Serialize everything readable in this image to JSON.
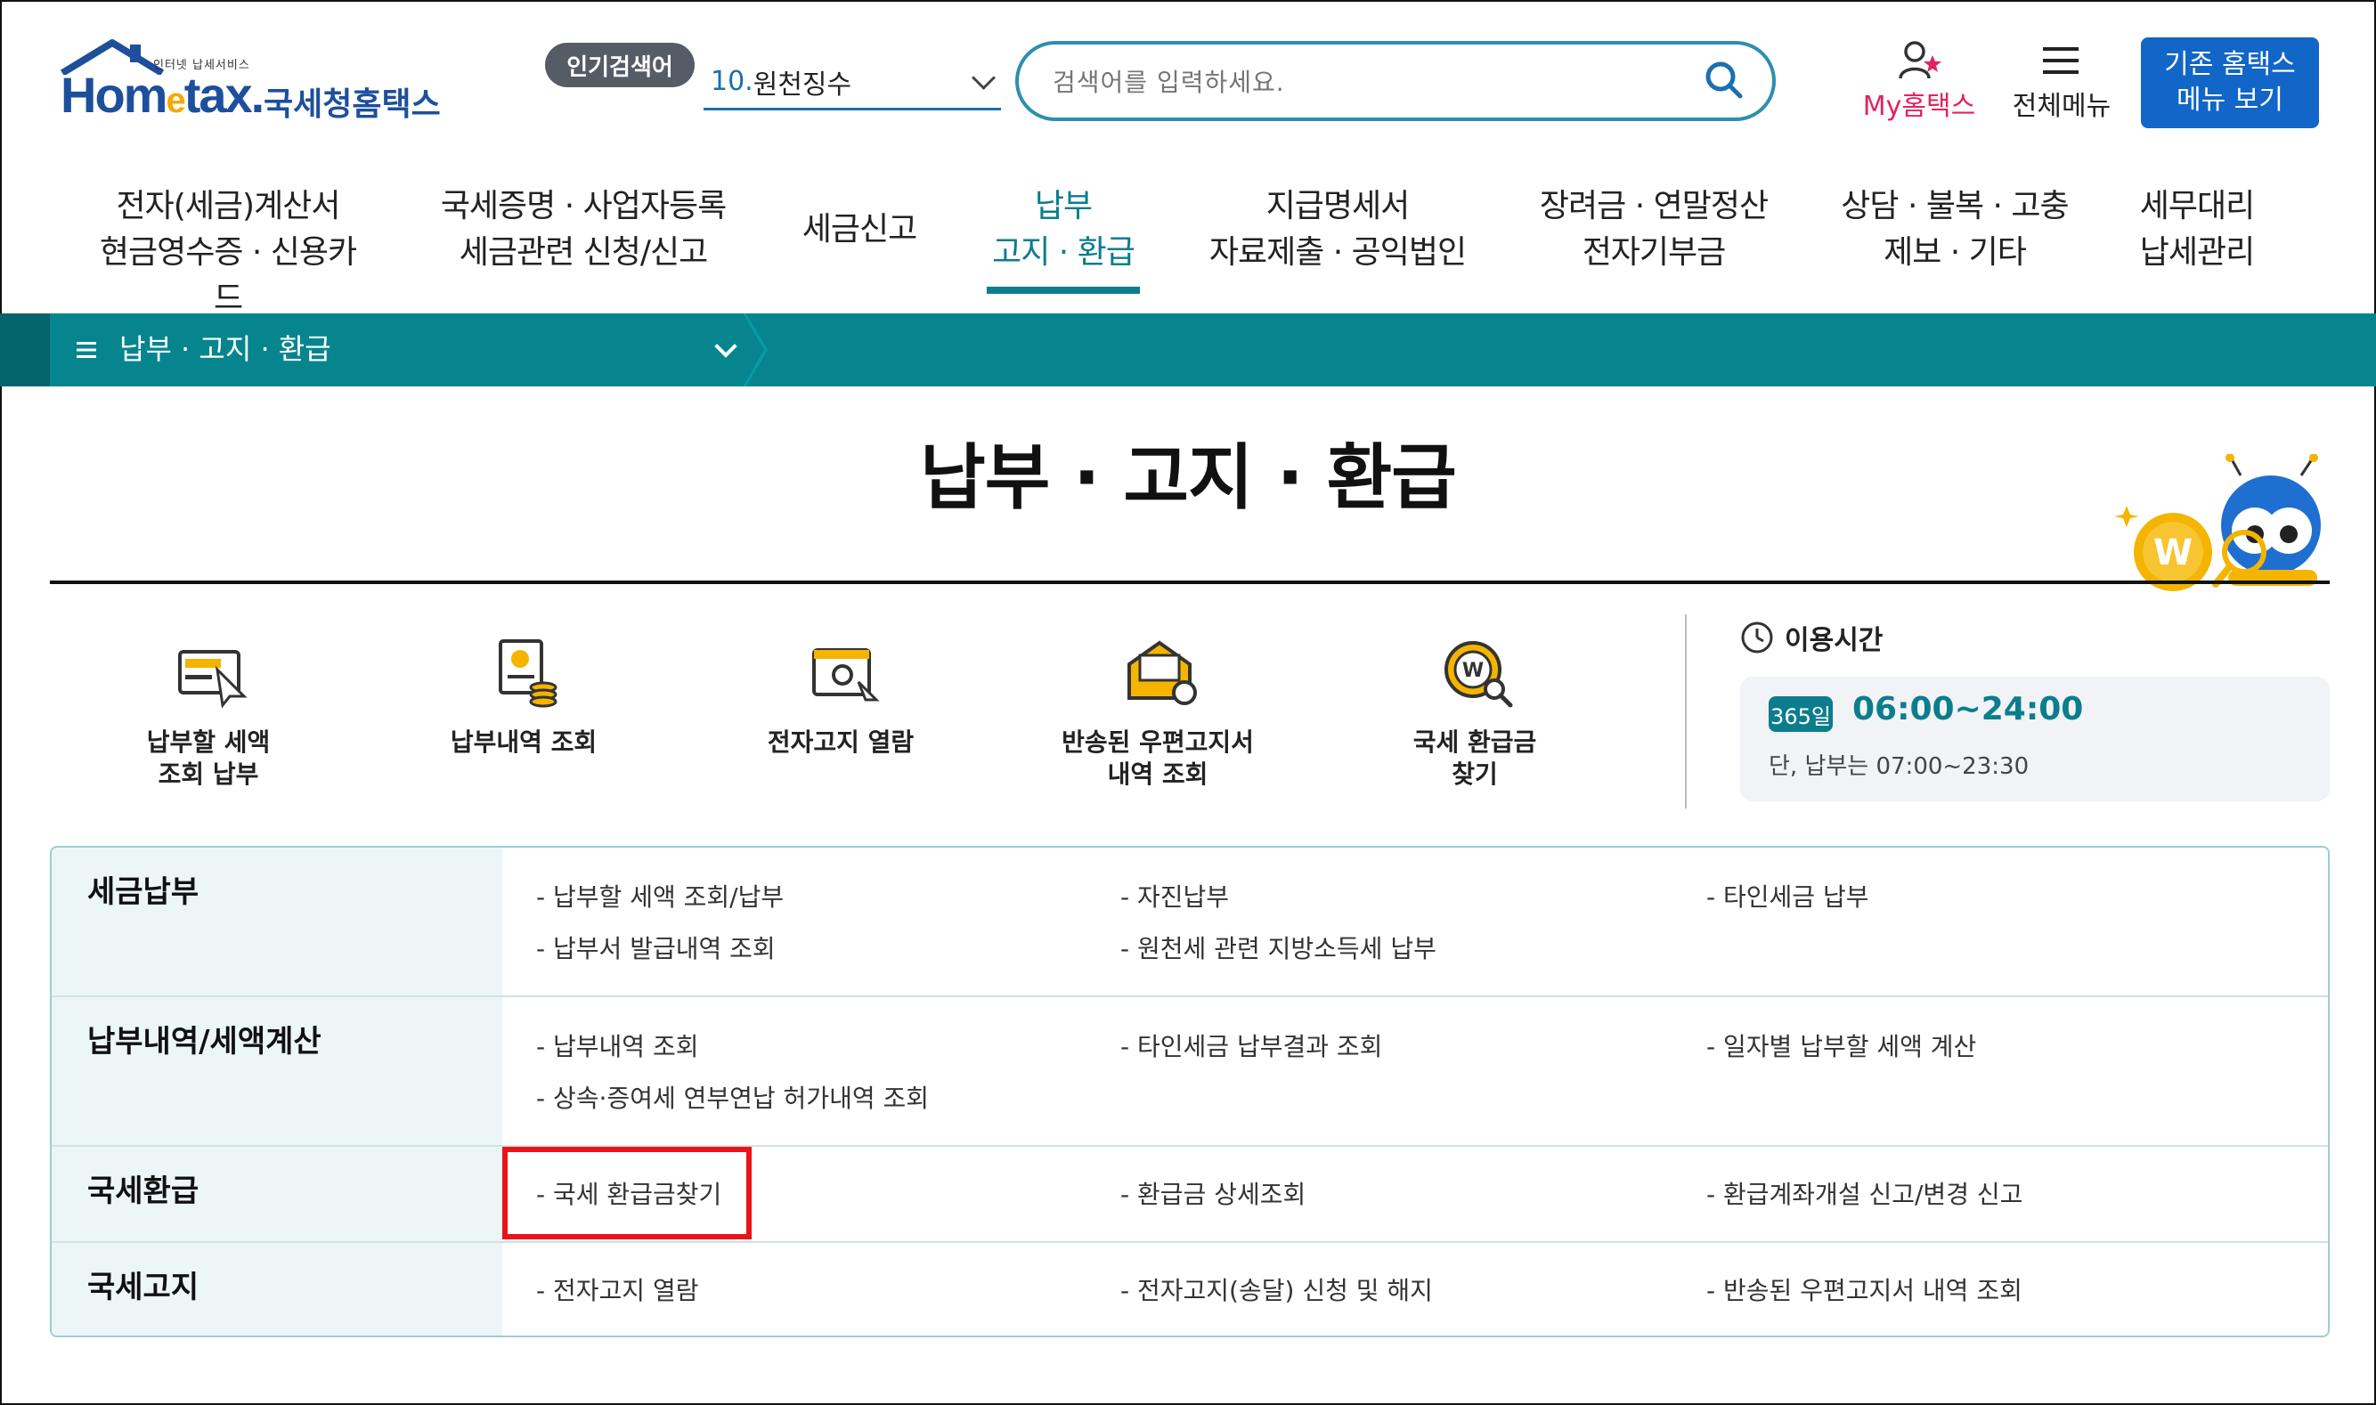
{
  "header": {
    "logo_small": "인터넷 납세서비스",
    "logo_main_prefix": "Hom",
    "logo_main_e": "e",
    "logo_main_suffix": "tax.",
    "logo_kr": "국세청홈택스",
    "popular_badge": "인기검색어",
    "popular_num": "10.",
    "popular_value": "원천징수",
    "search_placeholder": "검색어를 입력하세요.",
    "my_hometax": "My홈택스",
    "all_menu": "전체메뉴",
    "old_menu_line1": "기존 홈택스",
    "old_menu_line2": "메뉴 보기"
  },
  "gnb": [
    {
      "line1": "전자(세금)계산서",
      "line2": "현금영수증 · 신용카드"
    },
    {
      "line1": "국세증명 · 사업자등록",
      "line2": "세금관련 신청/신고"
    },
    {
      "line1": "세금신고",
      "line2": ""
    },
    {
      "line1": "납부",
      "line2": "고지 · 환급"
    },
    {
      "line1": "지급명세서",
      "line2": "자료제출 · 공익법인"
    },
    {
      "line1": "장려금 · 연말정산",
      "line2": "전자기부금"
    },
    {
      "line1": "상담 · 불복 · 고충",
      "line2": "제보 · 기타"
    },
    {
      "line1": "세무대리",
      "line2": "납세관리"
    }
  ],
  "breadcrumb": {
    "title": "납부 · 고지 · 환급"
  },
  "page_title": "납부 · 고지 · 환급",
  "quick_menu": [
    {
      "line1": "납부할 세액",
      "line2": "조회 납부",
      "icon": "tax-payment-icon"
    },
    {
      "line1": "납부내역 조회",
      "line2": "",
      "icon": "payment-history-icon"
    },
    {
      "line1": "전자고지 열람",
      "line2": "",
      "icon": "e-notice-icon"
    },
    {
      "line1": "반송된 우편고지서",
      "line2": "내역 조회",
      "icon": "returned-mail-icon"
    },
    {
      "line1": "국세 환급금",
      "line2": "찾기",
      "icon": "refund-search-icon"
    }
  ],
  "hours": {
    "title": "이용시간",
    "badge": "365일",
    "time": "06:00~24:00",
    "note": "단, 납부는 07:00~23:30"
  },
  "table": [
    {
      "category": "세금납부",
      "links": [
        "납부할 세액 조회/납부",
        "자진납부",
        "타인세금 납부",
        "납부서 발급내역 조회",
        "원천세 관련 지방소득세 납부"
      ]
    },
    {
      "category": "납부내역/세액계산",
      "links": [
        "납부내역 조회",
        "타인세금 납부결과 조회",
        "일자별 납부할 세액 계산",
        "상속·증여세 연부연납 허가내역 조회"
      ]
    },
    {
      "category": "국세환급",
      "links": [
        "국세 환급금찾기",
        "환급금 상세조회",
        "환급계좌개설 신고/변경 신고"
      ]
    },
    {
      "category": "국세고지",
      "links": [
        "전자고지 열람",
        "전자고지(송달) 신청 및 해지",
        "반송된 우편고지서 내역 조회"
      ]
    }
  ],
  "colors": {
    "brand_blue": "#1d4f9c",
    "teal": "#06858f",
    "highlight_red": "#e8141a",
    "my_pink": "#e0245e"
  }
}
